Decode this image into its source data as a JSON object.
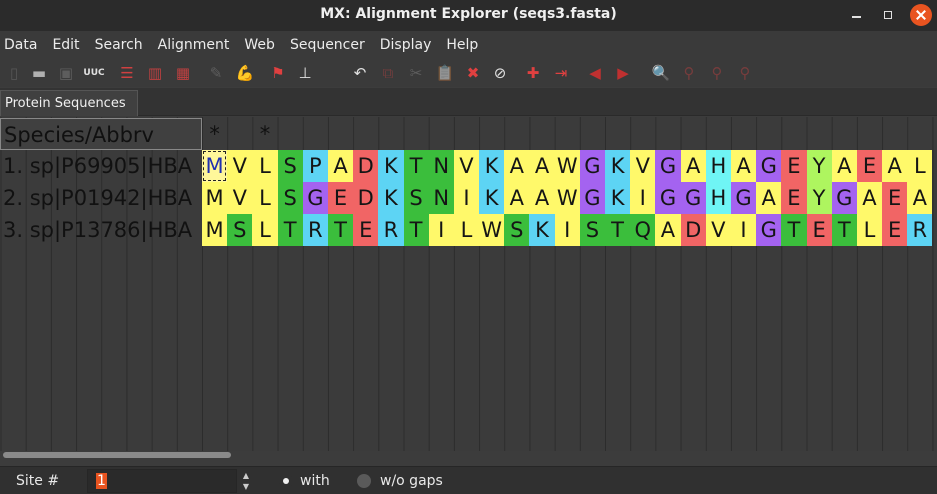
{
  "window": {
    "title": "MX: Alignment Explorer (seqs3.fasta)"
  },
  "menu": [
    "Data",
    "Edit",
    "Search",
    "Alignment",
    "Web",
    "Sequencer",
    "Display",
    "Help"
  ],
  "toolbar": [
    {
      "icon": "new-doc-icon",
      "glyph": "▯",
      "color": "#777",
      "disabled": true
    },
    {
      "icon": "open-folder-icon",
      "glyph": "▬",
      "color": "#b0b0b0",
      "disabled": false
    },
    {
      "icon": "save-icon",
      "glyph": "▣",
      "color": "#888",
      "disabled": true
    },
    {
      "icon": "translate-icon",
      "glyph": "UUC",
      "color": "#e0e0e0",
      "disabled": false
    },
    {
      "icon": "align-muscle-icon",
      "glyph": "☰",
      "color": "#d04040",
      "disabled": false
    },
    {
      "icon": "align-clustal-icon",
      "glyph": "▥",
      "color": "#c04040",
      "disabled": false
    },
    {
      "icon": "align-codons-icon",
      "glyph": "▦",
      "color": "#c04040",
      "disabled": false
    },
    {
      "icon": "wand-icon",
      "glyph": "✎",
      "color": "#888",
      "disabled": true
    },
    {
      "icon": "muscle-arm-icon",
      "glyph": "💪",
      "color": "#d04040",
      "disabled": false
    },
    {
      "icon": "flag-icon",
      "glyph": "⚑",
      "color": "#e04040",
      "disabled": false
    },
    {
      "icon": "mark-site-icon",
      "glyph": "⊥",
      "color": "#e0e0e0",
      "disabled": false
    },
    {
      "icon": "undo-icon",
      "glyph": "↶",
      "color": "#e0e0e0",
      "disabled": false
    },
    {
      "icon": "copy-icon",
      "glyph": "⧉",
      "color": "#b04040",
      "disabled": true
    },
    {
      "icon": "cut-icon",
      "glyph": "✂",
      "color": "#888",
      "disabled": true
    },
    {
      "icon": "paste-icon",
      "glyph": "📋",
      "color": "#888",
      "disabled": true
    },
    {
      "icon": "delete-icon",
      "glyph": "✖",
      "color": "#e04040",
      "disabled": false
    },
    {
      "icon": "delete-gaps-icon",
      "glyph": "⊘",
      "color": "#e0e0e0",
      "disabled": false
    },
    {
      "icon": "add-sequence-icon",
      "glyph": "✚",
      "color": "#e04040",
      "disabled": false
    },
    {
      "icon": "insert-icon",
      "glyph": "⇥",
      "color": "#e04040",
      "disabled": false
    },
    {
      "icon": "move-left-icon",
      "glyph": "◀",
      "color": "#c03030",
      "disabled": false
    },
    {
      "icon": "move-right-icon",
      "glyph": "▶",
      "color": "#c03030",
      "disabled": false
    },
    {
      "icon": "search-icon",
      "glyph": "🔍",
      "color": "#e04040",
      "disabled": false
    },
    {
      "icon": "find-prev-icon",
      "glyph": "⚲",
      "color": "#c04040",
      "disabled": true
    },
    {
      "icon": "find-next-icon",
      "glyph": "⚲",
      "color": "#c04040",
      "disabled": true
    },
    {
      "icon": "find-motif-icon",
      "glyph": "⚲",
      "color": "#c04040",
      "disabled": true
    }
  ],
  "tab": {
    "label": "Protein Sequences"
  },
  "grid": {
    "header_label": "Species/Abbrv",
    "conservation": [
      "*",
      "",
      "*",
      "",
      "",
      "",
      "",
      "",
      "",
      "",
      "",
      "",
      "",
      "",
      "",
      "",
      "",
      "",
      "",
      "",
      "",
      "",
      "",
      "",
      "",
      "",
      "",
      "",
      "",
      ""
    ],
    "sequences": [
      {
        "name": "1. sp|P69905|HBA",
        "residues": "MVLSPADKTNVKAAWGKVGAHAGEYAEAL"
      },
      {
        "name": "2. sp|P01942|HBA",
        "residues": "MVLSGEDKSNIKAAWGKIGGHGAEYGAEA"
      },
      {
        "name": "3. sp|P13786|HBA",
        "residues": "MSLTRTERTILWSKISTQADVIGTETLER"
      }
    ],
    "focused_cell": {
      "row": 0,
      "col": 0
    },
    "colors": {
      "A": "#fff96a",
      "V": "#fff96a",
      "L": "#fff96a",
      "I": "#fff96a",
      "M": "#fff96a",
      "F": "#fff96a",
      "W": "#fff96a",
      "G": "#a463f0",
      "H": "#6ff5f5",
      "S": "#3bbe3c",
      "T": "#3bbe3c",
      "Q": "#3bbe3c",
      "N": "#3bbe3c",
      "Y": "#aef55f",
      "C": "#3bbe3c",
      "D": "#f16565",
      "E": "#f16565",
      "K": "#5dd4f4",
      "R": "#5dd4f4",
      "P": "#5dd4f4"
    }
  },
  "status": {
    "site_label": "Site #",
    "site_value": "1",
    "with_label": "with",
    "without_label": "w/o gaps",
    "with_gaps_selected": true
  }
}
